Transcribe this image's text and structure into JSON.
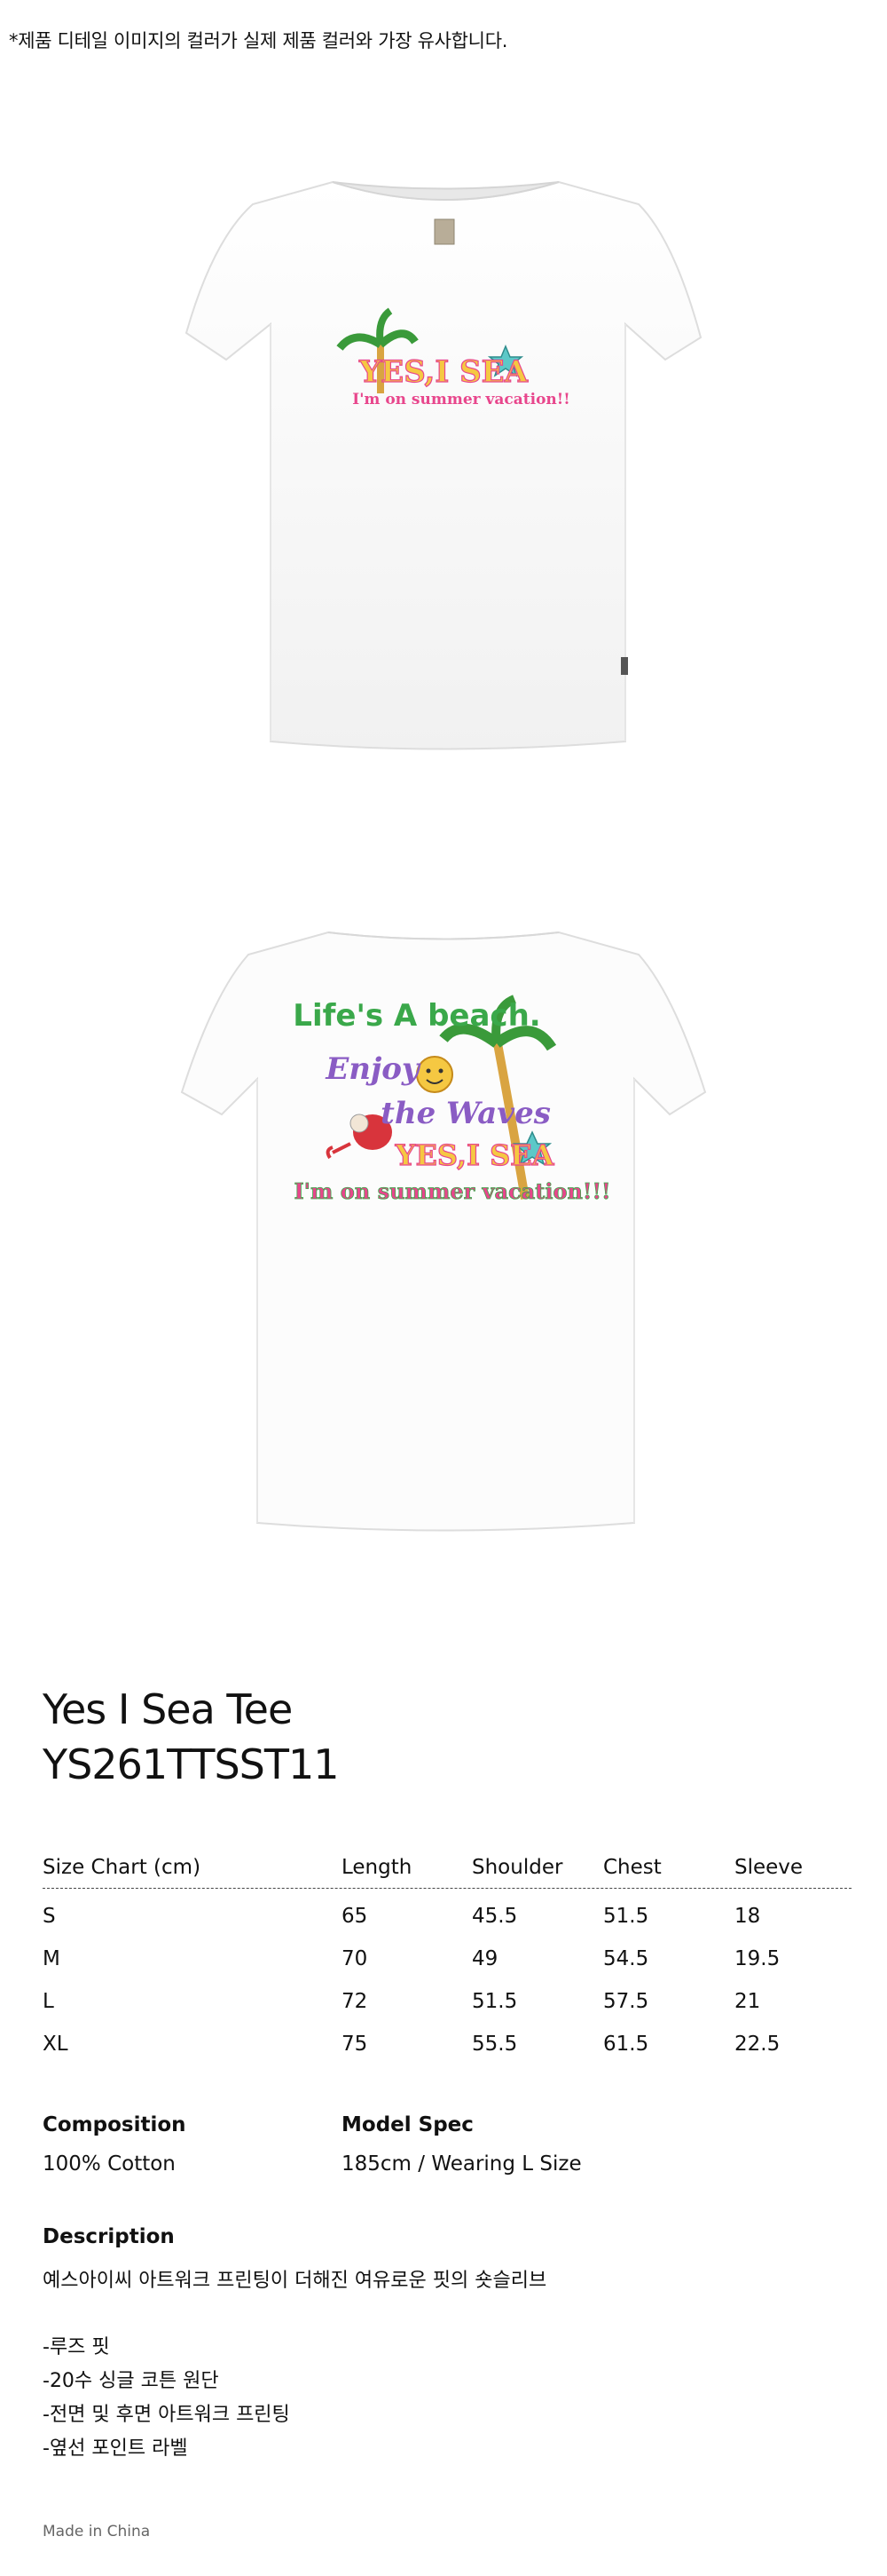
{
  "notice": "*제품 디테일 이미지의 컬러가 실제 제품 컬러와 가장 유사합니다.",
  "front_graphic": {
    "line1": "YES,I SEA",
    "line2": "I'm on summer vacation!!"
  },
  "back_graphic": {
    "line1": "Life's A beach.",
    "line2": "Enjoy",
    "line3": "the Waves",
    "line4": "YES,I SEA",
    "line5": "I'm on summer vacation!!!"
  },
  "product": {
    "name": "Yes I Sea Tee",
    "code": "YS261TTSST11"
  },
  "size_chart": {
    "headers": [
      "Size Chart (cm)",
      "Length",
      "Shoulder",
      "Chest",
      "Sleeve"
    ],
    "rows": [
      [
        "S",
        "65",
        "45.5",
        "51.5",
        "18"
      ],
      [
        "M",
        "70",
        "49",
        "54.5",
        "19.5"
      ],
      [
        "L",
        "72",
        "51.5",
        "57.5",
        "21"
      ],
      [
        "XL",
        "75",
        "55.5",
        "61.5",
        "22.5"
      ]
    ]
  },
  "composition": {
    "label": "Composition",
    "value": "100% Cotton"
  },
  "model_spec": {
    "label": "Model Spec",
    "value": "185cm / Wearing L Size"
  },
  "description": {
    "label": "Description",
    "intro": "예스아이씨 아트워크 프린팅이 더해진 여유로운 핏의 숏슬리브",
    "bullets": [
      "-루즈 핏",
      "-20수 싱글 코튼 원단",
      "-전면 및 후면 아트워크 프린팅",
      "-옆선 포인트 라벨"
    ]
  },
  "made_in": "Made in China",
  "colors": {
    "shirt": "#fafafa",
    "shirt_shadow": "#e4e4e4",
    "palm_green": "#3a9a3a",
    "yellow": "#f5c842",
    "pink": "#e8468c",
    "purple": "#8a5cc4",
    "star_teal": "#5cc8c8",
    "crab_red": "#d8343c"
  }
}
